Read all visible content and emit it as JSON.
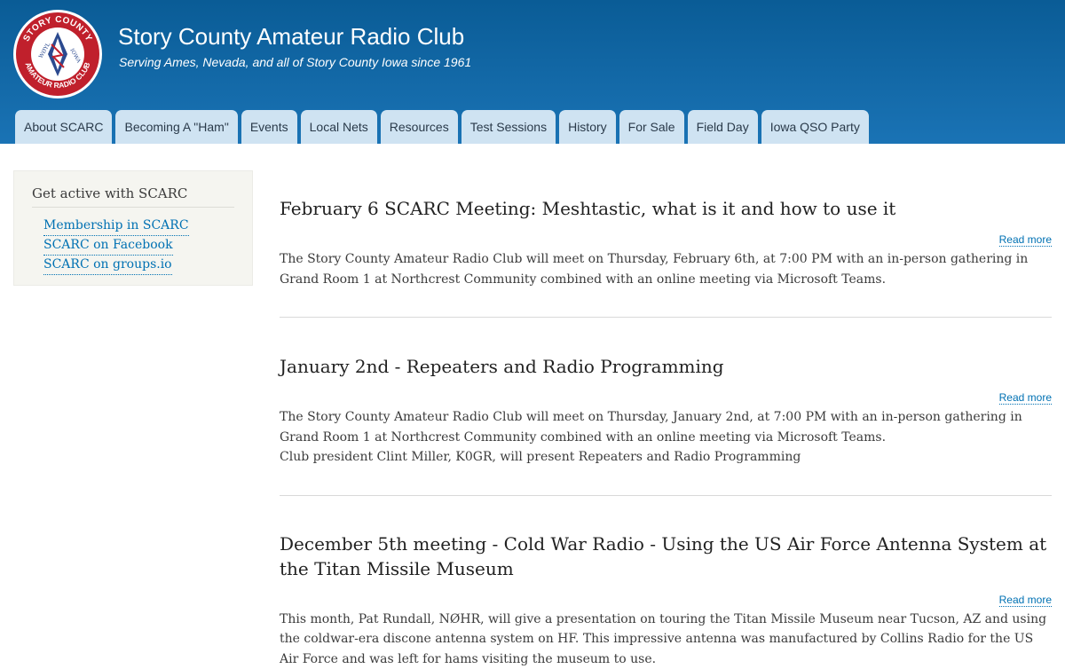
{
  "site": {
    "name": "Story County Amateur Radio Club",
    "slogan": "Serving Ames, Nevada, and all of Story County Iowa since 1961",
    "logo": {
      "text_top": "STORY COUNTY",
      "text_bottom": "AMATEUR RADIO CLUB",
      "callsign": "WØYL",
      "state": "IOWA",
      "colors": {
        "ring": "#c0202c",
        "inner": "#ffffff",
        "diamond": "#2b4a8f"
      }
    }
  },
  "nav": {
    "tabs": [
      "About SCARC",
      "Becoming A \"Ham\"",
      "Events",
      "Local Nets",
      "Resources",
      "Test Sessions",
      "History",
      "For Sale",
      "Field Day",
      "Iowa QSO Party"
    ]
  },
  "sidebar": {
    "title": "Get active with SCARC",
    "links": [
      "Membership in SCARC",
      "SCARC on Facebook",
      "SCARC on groups.io"
    ]
  },
  "articles": [
    {
      "title": "February 6 SCARC Meeting: Meshtastic, what is it and how to use it",
      "read_more": "Read more",
      "body": [
        "The Story County Amateur Radio Club will meet on Thursday, February 6th, at 7:00 PM with an in-person gathering in Grand Room 1 at Northcrest Community combined with an online meeting via Microsoft Teams."
      ]
    },
    {
      "title": "January 2nd - Repeaters and Radio Programming",
      "read_more": "Read more",
      "body": [
        "The Story County Amateur Radio Club will meet on Thursday, January 2nd, at 7:00 PM with an in-person gathering in Grand Room 1 at Northcrest Community combined with an online meeting via Microsoft Teams.",
        "Club president Clint Miller, K0GR, will present Repeaters and Radio Programming"
      ]
    },
    {
      "title": "December 5th meeting - Cold War Radio - Using the US Air Force Antenna System at the Titan Missile Museum",
      "read_more": "Read more",
      "body": [
        "This month, Pat Rundall, NØHR, will give a presentation on touring the Titan Missile Museum near Tucson, AZ and using the coldwar-era discone antenna system on HF. This impressive antenna was manufactured by Collins Radio for the US Air Force and was left for hams visiting the museum to use."
      ]
    }
  ],
  "colors": {
    "header": "#1a73b5",
    "tab": "#cfe3f2",
    "link": "#0071b3",
    "sidebar_bg": "#f5f5f0"
  }
}
